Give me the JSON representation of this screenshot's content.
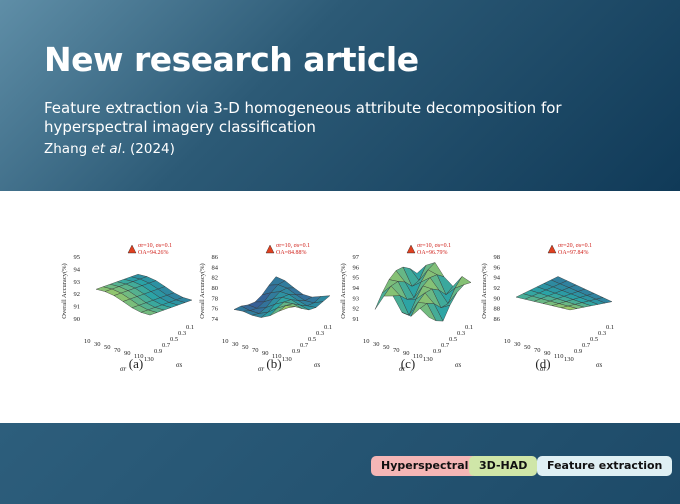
{
  "header": {
    "headline": "New research article",
    "subtitle": "Feature extraction via 3-D homogeneous attribute decomposition for hyperspectral imagery classification",
    "authors_prefix": "Zhang ",
    "authors_etal": "et al",
    "authors_suffix": ". (2024)"
  },
  "figure": {
    "panels": [
      {
        "label": "(a)",
        "ylabel": "Overall Accuracy(%)",
        "yticks": [
          "95",
          "94",
          "93",
          "92",
          "91",
          "90"
        ],
        "annotation_line1": "σr=10, σs=0.1",
        "annotation_line2": "OA=94.26%"
      },
      {
        "label": "(b)",
        "ylabel": "Overall Accuracy(%)",
        "yticks": [
          "86",
          "84",
          "82",
          "80",
          "78",
          "76",
          "74"
        ],
        "annotation_line1": "σr=10, σs=0.1",
        "annotation_line2": "OA=84.88%"
      },
      {
        "label": "(c)",
        "ylabel": "Overall Accuracy(%)",
        "yticks": [
          "97",
          "96",
          "95",
          "94",
          "93",
          "92",
          "91"
        ],
        "annotation_line1": "σr=10, σs=0.1",
        "annotation_line2": "OA=96.79%"
      },
      {
        "label": "(d)",
        "ylabel": "Overall Accuracy(%)",
        "yticks": [
          "98",
          "96",
          "94",
          "92",
          "90",
          "88",
          "86"
        ],
        "annotation_line1": "σr=20, σs=0.1",
        "annotation_line2": "OA=97.84%"
      }
    ],
    "x_ticks": [
      "10",
      "30",
      "50",
      "70",
      "90",
      "110",
      "130"
    ],
    "z_ticks": [
      "0.1",
      "0.3",
      "0.5",
      "0.7",
      "0.9"
    ],
    "x_axis_label": "σr",
    "z_axis_label": "σs"
  },
  "tags": [
    {
      "label": "Hyperspectral",
      "color": "#f4b6b6"
    },
    {
      "label": "3D-HAD",
      "color": "#cfe6a8"
    },
    {
      "label": "Feature extraction",
      "color": "#dff0f4"
    }
  ],
  "colors": {
    "header_dark": "#103a58",
    "footer": "#1d4a68",
    "surface_low": "#3b3f8f",
    "surface_mid": "#2aa3a6",
    "surface_high": "#f0e43c"
  }
}
